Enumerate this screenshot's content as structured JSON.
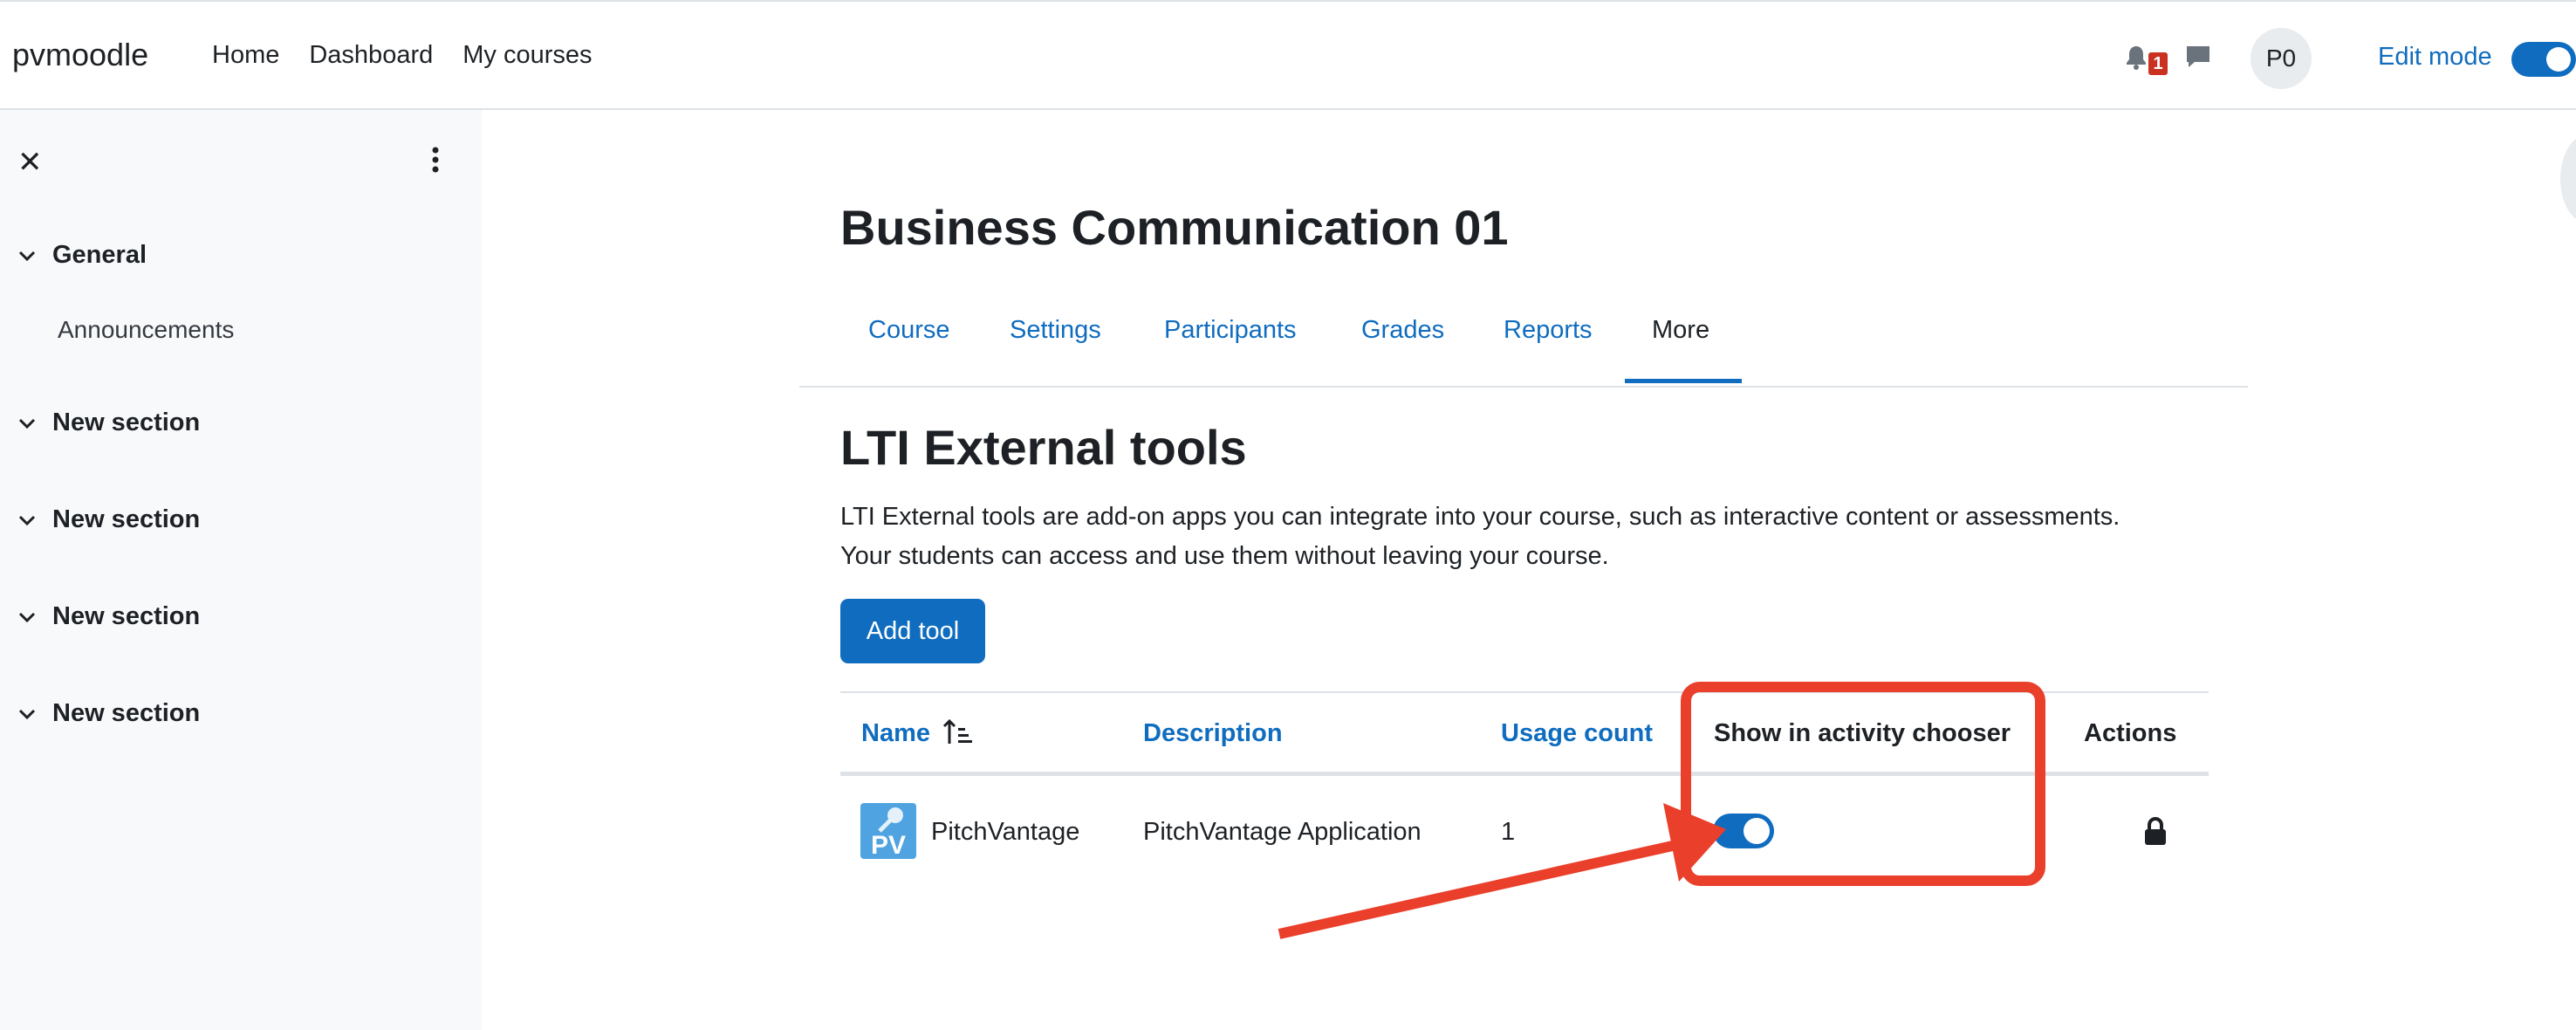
{
  "navbar": {
    "brand": "pvmoodle",
    "links": [
      "Home",
      "Dashboard",
      "My courses"
    ],
    "notification_count": "1",
    "avatar_initials": "P0",
    "edit_mode_label": "Edit mode",
    "edit_mode_on": true
  },
  "drawer": {
    "sections": [
      {
        "label": "General",
        "items": [
          "Announcements"
        ]
      },
      {
        "label": "New section"
      },
      {
        "label": "New section"
      },
      {
        "label": "New section"
      },
      {
        "label": "New section"
      }
    ]
  },
  "course": {
    "title": "Business Communication 01",
    "tabs": [
      "Course",
      "Settings",
      "Participants",
      "Grades",
      "Reports",
      "More"
    ],
    "active_tab": "More"
  },
  "page": {
    "heading": "LTI External tools",
    "description_line1": "LTI External tools are add-on apps you can integrate into your course, such as interactive content or assessments.",
    "description_line2": "Your students can access and use them without leaving your course.",
    "add_tool_label": "Add tool"
  },
  "table": {
    "headers": {
      "name": "Name",
      "description": "Description",
      "usage": "Usage count",
      "chooser": "Show in activity chooser",
      "actions": "Actions"
    },
    "rows": [
      {
        "logo_text": "PV",
        "name": "PitchVantage",
        "description": "PitchVantage Application",
        "usage": "1",
        "show_in_chooser": true
      }
    ]
  },
  "colors": {
    "primary": "#0f6cbf",
    "annotation": "#ea3f2b",
    "drawer_bg": "#f8f9fa",
    "logo_bg": "#4ea3e0"
  }
}
